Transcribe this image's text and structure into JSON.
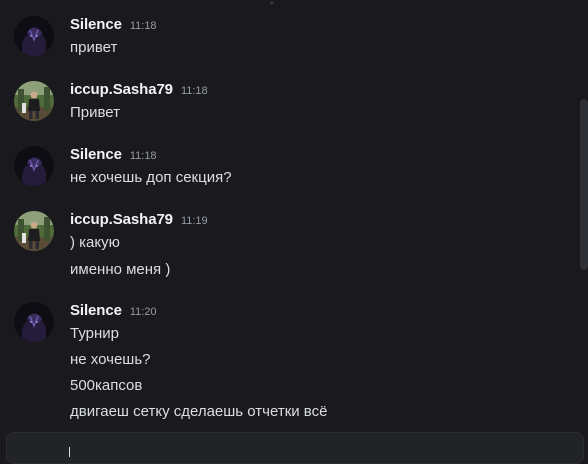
{
  "messages": [
    {
      "user": "Silence",
      "time": "11:18",
      "avatar": "dark-purple-character-avatar",
      "lines": [
        "привет"
      ]
    },
    {
      "user": "iccup.Sasha79",
      "time": "11:18",
      "avatar": "outdoor-photo-avatar",
      "lines": [
        "Привет"
      ]
    },
    {
      "user": "Silence",
      "time": "11:18",
      "avatar": "dark-purple-character-avatar",
      "lines": [
        "не хочешь доп секция?"
      ]
    },
    {
      "user": "iccup.Sasha79",
      "time": "11:19",
      "avatar": "outdoor-photo-avatar",
      "lines": [
        ") какую",
        "именно меня )"
      ]
    },
    {
      "user": "Silence",
      "time": "11:20",
      "avatar": "dark-purple-character-avatar",
      "lines": [
        "Турнир",
        "не хочешь?",
        "500капсов",
        "двигаеш сетку сделаешь отчетки всё"
      ]
    }
  ],
  "colors": {
    "background": "#1a1a1e",
    "username": "#f2f3f5",
    "timestamp": "#949ba4",
    "text": "#dbdee1"
  }
}
